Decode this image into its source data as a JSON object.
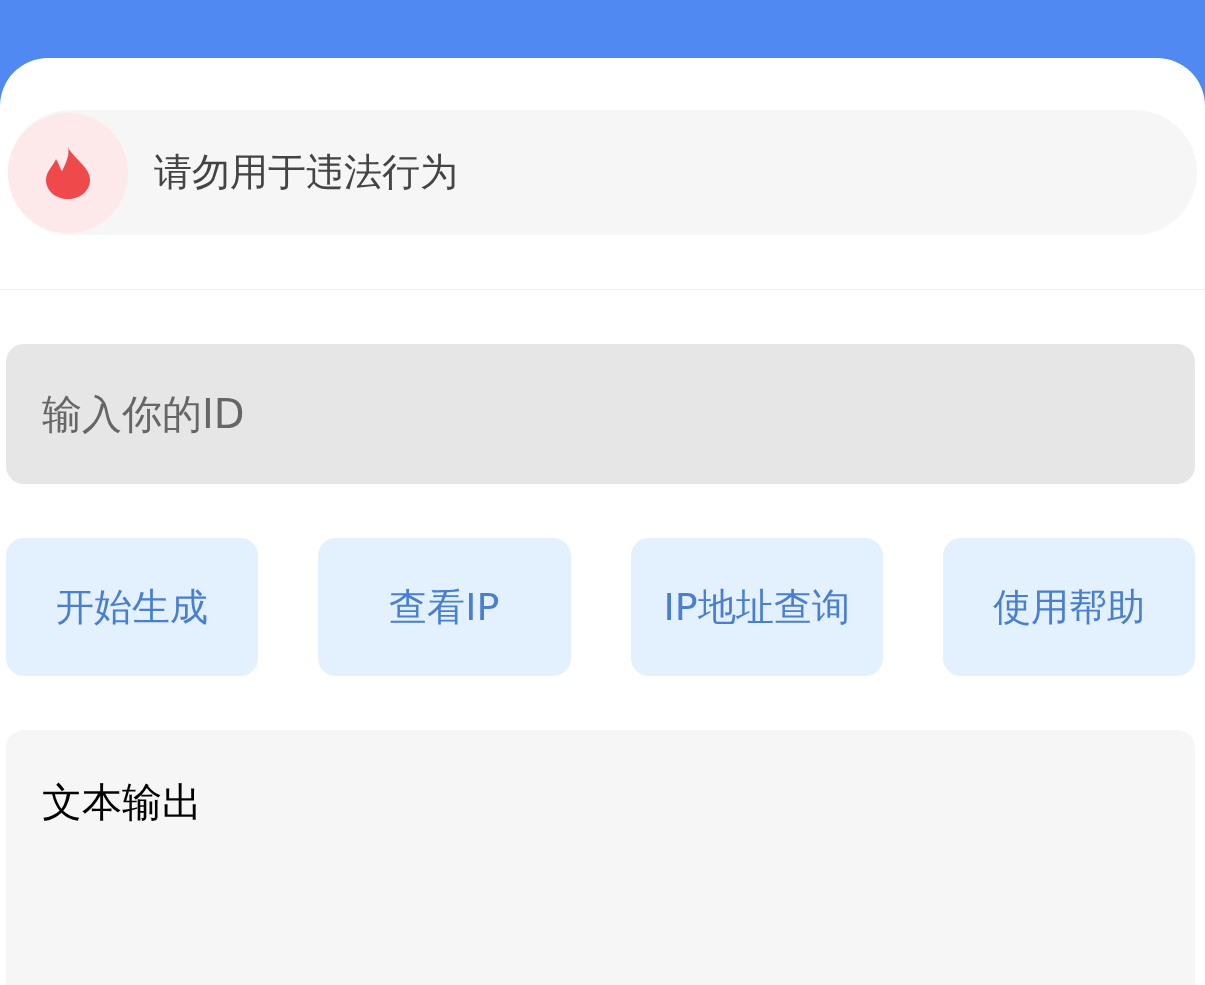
{
  "notice": {
    "text": "请勿用于违法行为"
  },
  "id_field": {
    "placeholder": "输入你的ID"
  },
  "buttons": [
    {
      "label": "开始生成"
    },
    {
      "label": "查看IP"
    },
    {
      "label": "IP地址查询"
    },
    {
      "label": "使用帮助"
    }
  ],
  "output": {
    "title": "文本输出"
  }
}
